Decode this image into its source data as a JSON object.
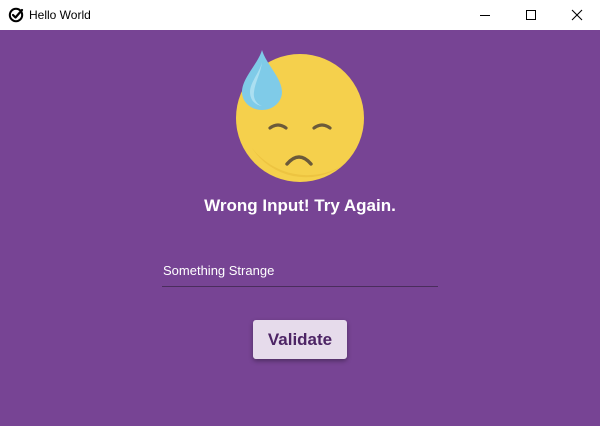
{
  "window": {
    "title": "Hello World",
    "controls": {
      "minimize": "minimize",
      "maximize": "maximize",
      "close": "close"
    }
  },
  "main": {
    "status_icon": "sad-sweat-emoji-icon",
    "message": "Wrong Input! Try Again.",
    "input": {
      "value": "Something Strange",
      "placeholder": ""
    },
    "validate_label": "Validate"
  },
  "colors": {
    "background": "#774494",
    "button_bg": "#e6dbeb",
    "button_text": "#4d2465",
    "emoji_face": "#f5d04c",
    "sweat_drop": "#7fcbe8"
  }
}
